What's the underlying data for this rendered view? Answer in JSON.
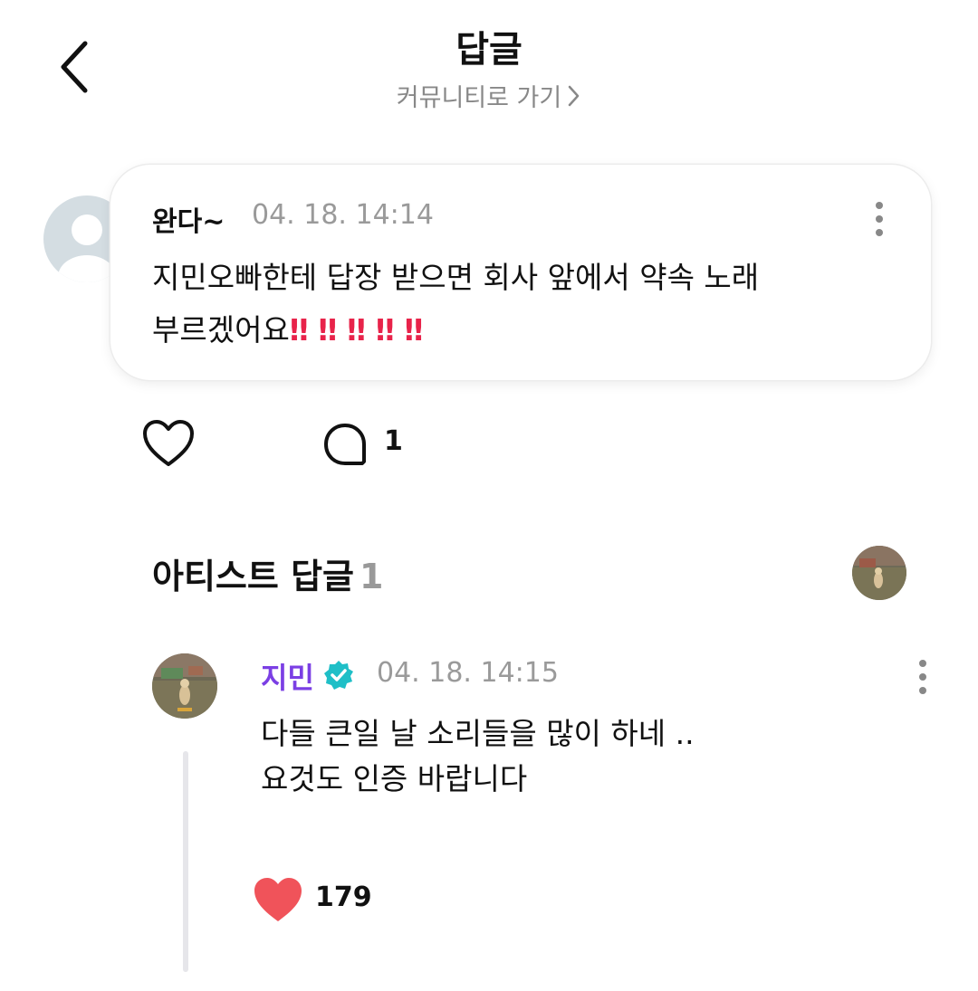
{
  "header": {
    "title": "답글",
    "community_link": "커뮤니티로 가기"
  },
  "comment": {
    "author": "완다~",
    "timestamp": "04. 18. 14:14",
    "text_line1": "지민오빠한테 답장 받으면 회사 앞에서 약속 노래",
    "text_line2": "부르겠어요",
    "emoji": [
      "‼",
      "‼",
      "‼",
      "‼",
      "‼"
    ],
    "reply_count": "1"
  },
  "artist_replies": {
    "title": "아티스트 답글",
    "count": "1"
  },
  "artist_reply": {
    "author": "지민",
    "timestamp": "04. 18. 14:15",
    "text_line1": "다들 큰일 날 소리들을 많이 하네 ..",
    "text_line2": "요것도 인증 바랍니다",
    "like_count": "179"
  },
  "colors": {
    "artist_name": "#7b3fe4",
    "verified_badge": "#1fbfc7",
    "like_active": "#f0535a",
    "exclamation": "#e8234a",
    "timestamp": "#9a9a9a"
  },
  "icons": [
    "back-arrow-icon",
    "chevron-right-icon",
    "more-vertical-icon",
    "heart-outline-icon",
    "comment-bubble-icon",
    "verified-badge-icon",
    "heart-filled-icon"
  ]
}
